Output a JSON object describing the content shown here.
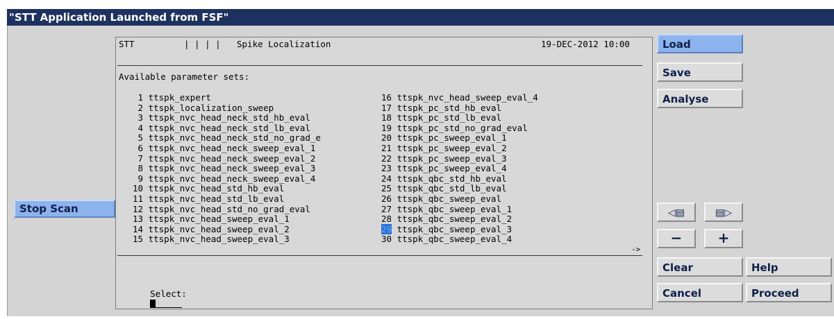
{
  "window": {
    "title": "\"STT Application Launched from FSF\""
  },
  "left": {
    "stop_scan_label": "Stop Scan"
  },
  "terminal": {
    "header_app": "STT",
    "header_sep": "| | | |",
    "header_title": "Spike Localization",
    "header_date": "19-DEC-2012 10:00",
    "available_label": "Available parameter sets:",
    "left_items": [
      {
        "num": " 1",
        "name": "ttspk_expert"
      },
      {
        "num": " 2",
        "name": "ttspk_localization_sweep"
      },
      {
        "num": " 3",
        "name": "ttspk_nvc_head_neck_std_hb_eval"
      },
      {
        "num": " 4",
        "name": "ttspk_nvc_head_neck_std_lb_eval"
      },
      {
        "num": " 5",
        "name": "ttspk_nvc_head_neck_std_no_grad_e"
      },
      {
        "num": " 6",
        "name": "ttspk_nvc_head_neck_sweep_eval_1"
      },
      {
        "num": " 7",
        "name": "ttspk_nvc_head_neck_sweep_eval_2"
      },
      {
        "num": " 8",
        "name": "ttspk_nvc_head_neck_sweep_eval_3"
      },
      {
        "num": " 9",
        "name": "ttspk_nvc_head_neck_sweep_eval_4"
      },
      {
        "num": "10",
        "name": "ttspk_nvc_head_std_hb_eval"
      },
      {
        "num": "11",
        "name": "ttspk_nvc_head_std_lb_eval"
      },
      {
        "num": "12",
        "name": "ttspk_nvc_head_std_no_grad_eval"
      },
      {
        "num": "13",
        "name": "ttspk_nvc_head_sweep_eval_1"
      },
      {
        "num": "14",
        "name": "ttspk_nvc_head_sweep_eval_2"
      },
      {
        "num": "15",
        "name": "ttspk_nvc_head_sweep_eval_3"
      }
    ],
    "right_items": [
      {
        "num": "16",
        "name": "ttspk_nvc_head_sweep_eval_4"
      },
      {
        "num": "17",
        "name": "ttspk_pc_std_hb_eval"
      },
      {
        "num": "18",
        "name": "ttspk_pc_std_lb_eval"
      },
      {
        "num": "19",
        "name": "ttspk_pc_std_no_grad_eval"
      },
      {
        "num": "20",
        "name": "ttspk_pc_sweep_eval_1"
      },
      {
        "num": "21",
        "name": "ttspk_pc_sweep_eval_2"
      },
      {
        "num": "22",
        "name": "ttspk_pc_sweep_eval_3"
      },
      {
        "num": "23",
        "name": "ttspk_pc_sweep_eval_4"
      },
      {
        "num": "24",
        "name": "ttspk_qbc_std_hb_eval"
      },
      {
        "num": "25",
        "name": "ttspk_qbc_std_lb_eval"
      },
      {
        "num": "26",
        "name": "ttspk_qbc_sweep_eval"
      },
      {
        "num": "27",
        "name": "ttspk_qbc_sweep_eval_1"
      },
      {
        "num": "28",
        "name": "ttspk_qbc_sweep_eval_2"
      },
      {
        "num": "29",
        "name": "ttspk_qbc_sweep_eval_3",
        "highlighted": true
      },
      {
        "num": "30",
        "name": "ttspk_qbc_sweep_eval_4"
      }
    ],
    "more_arrow": "->",
    "select_label": "Select:"
  },
  "buttons": {
    "load": "Load",
    "save": "Save",
    "analyse": "Analyse",
    "prev_page_icon": "◁▤",
    "next_page_icon": "▤▷",
    "minus": "−",
    "plus": "+",
    "clear": "Clear",
    "help": "Help",
    "cancel": "Cancel",
    "proceed": "Proceed"
  },
  "colors": {
    "title_bg": "#1e3260",
    "active_button": "#8db3ee",
    "selection_highlight": "#2b72d6"
  }
}
